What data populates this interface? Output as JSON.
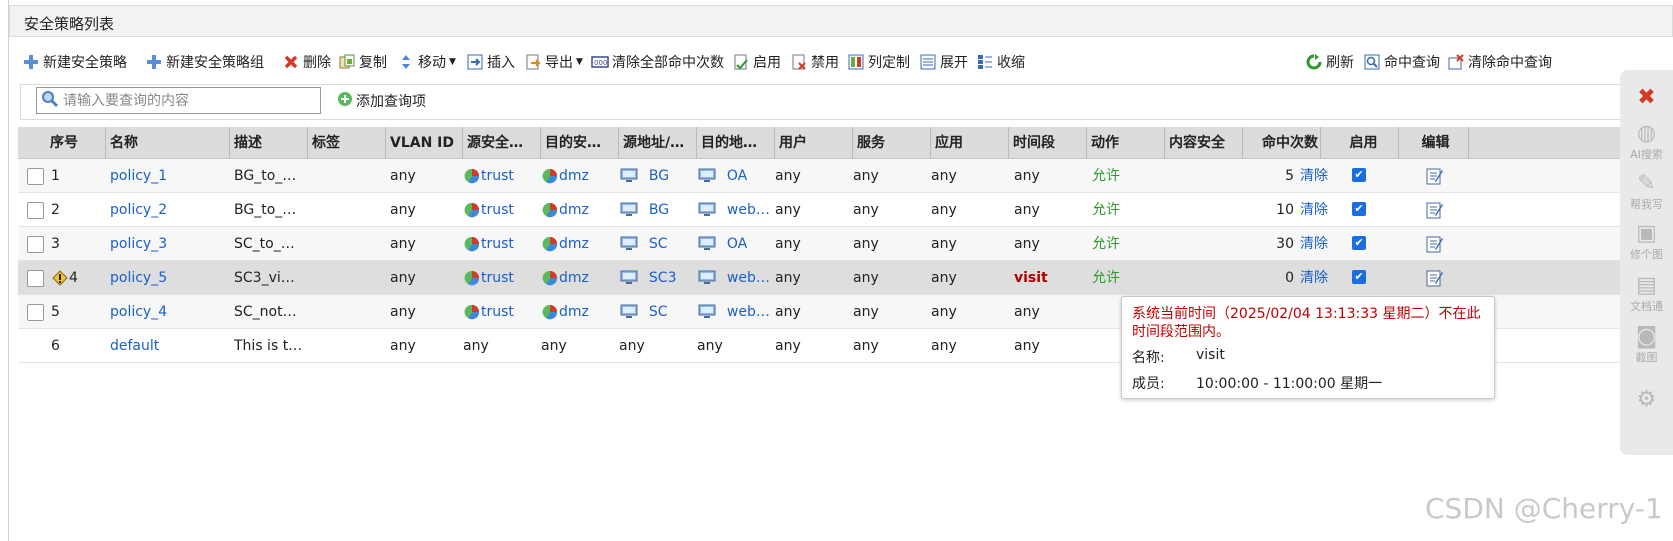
{
  "panel": {
    "title": "安全策略列表"
  },
  "toolbar": {
    "new_policy": "新建安全策略",
    "new_group": "新建安全策略组",
    "delete": "删除",
    "copy": "复制",
    "move": "移动",
    "insert": "插入",
    "export": "导出",
    "clear_hits": "清除全部命中次数",
    "enable": "启用",
    "disable": "禁用",
    "customize": "列定制",
    "expand": "展开",
    "collapse": "收缩",
    "refresh": "刷新",
    "hit_query": "命中查询",
    "clear_hit_query": "清除命中查询"
  },
  "search": {
    "placeholder": "请输入要查询的内容",
    "add_query": "添加查询项"
  },
  "columns": [
    "序号",
    "名称",
    "描述",
    "标签",
    "VLAN ID",
    "源安全…",
    "目的安…",
    "源地址/…",
    "目的地…",
    "用户",
    "服务",
    "应用",
    "时间段",
    "动作",
    "内容安全",
    "命中次数",
    "启用",
    "编辑"
  ],
  "rows": [
    {
      "seq": "1",
      "name": "policy_1",
      "desc": "BG_to_…",
      "vlan": "any",
      "src_zone": "trust",
      "dst_zone": "dmz",
      "src_addr": "BG",
      "dst_addr": "OA",
      "user": "any",
      "service": "any",
      "app": "any",
      "time": "any",
      "action": "允许",
      "hits": "5",
      "clear": "清除"
    },
    {
      "seq": "2",
      "name": "policy_2",
      "desc": "BG_to_…",
      "vlan": "any",
      "src_zone": "trust",
      "dst_zone": "dmz",
      "src_addr": "BG",
      "dst_addr": "web…",
      "user": "any",
      "service": "any",
      "app": "any",
      "time": "any",
      "action": "允许",
      "hits": "10",
      "clear": "清除"
    },
    {
      "seq": "3",
      "name": "policy_3",
      "desc": "SC_to_…",
      "vlan": "any",
      "src_zone": "trust",
      "dst_zone": "dmz",
      "src_addr": "SC",
      "dst_addr": "OA",
      "user": "any",
      "service": "any",
      "app": "any",
      "time": "any",
      "action": "允许",
      "hits": "30",
      "clear": "清除"
    },
    {
      "seq": "4",
      "name": "policy_5",
      "desc": "SC3_vi…",
      "vlan": "any",
      "src_zone": "trust",
      "dst_zone": "dmz",
      "src_addr": "SC3",
      "dst_addr": "web…",
      "user": "any",
      "service": "any",
      "app": "any",
      "time": "visit",
      "action": "允许",
      "hits": "0",
      "clear": "清除"
    },
    {
      "seq": "5",
      "name": "policy_4",
      "desc": "SC_not…",
      "vlan": "any",
      "src_zone": "trust",
      "dst_zone": "dmz",
      "src_addr": "SC",
      "dst_addr": "web…",
      "user": "any",
      "service": "any",
      "app": "any",
      "time": "any"
    },
    {
      "seq": "6",
      "name": "default",
      "desc": "This is t…",
      "vlan": "any",
      "src_zone": "any",
      "dst_zone": "any",
      "src_addr": "any",
      "dst_addr": "any",
      "user": "any",
      "service": "any",
      "app": "any",
      "time": "any"
    }
  ],
  "tooltip": {
    "warning_line1": "系统当前时间（2025/02/04 13:13:33 星期二）不在此",
    "warning_line2": "时间段范围内。",
    "name_label": "名称:",
    "name_value": "visit",
    "member_label": "成员:",
    "member_value": "10:00:00 - 11:00:00 星期一"
  },
  "sidebar": {
    "ai_search": "AI搜索",
    "help_write": "帮我写",
    "edit_image": "修个图",
    "doc": "文档通",
    "screenshot": "截图"
  },
  "watermark": "CSDN @Cherry-1",
  "colors": {
    "link": "#1a5fcc",
    "allow": "#2e9a2e",
    "time_warn": "#b00000",
    "header_bg": "#dcdcdc"
  }
}
